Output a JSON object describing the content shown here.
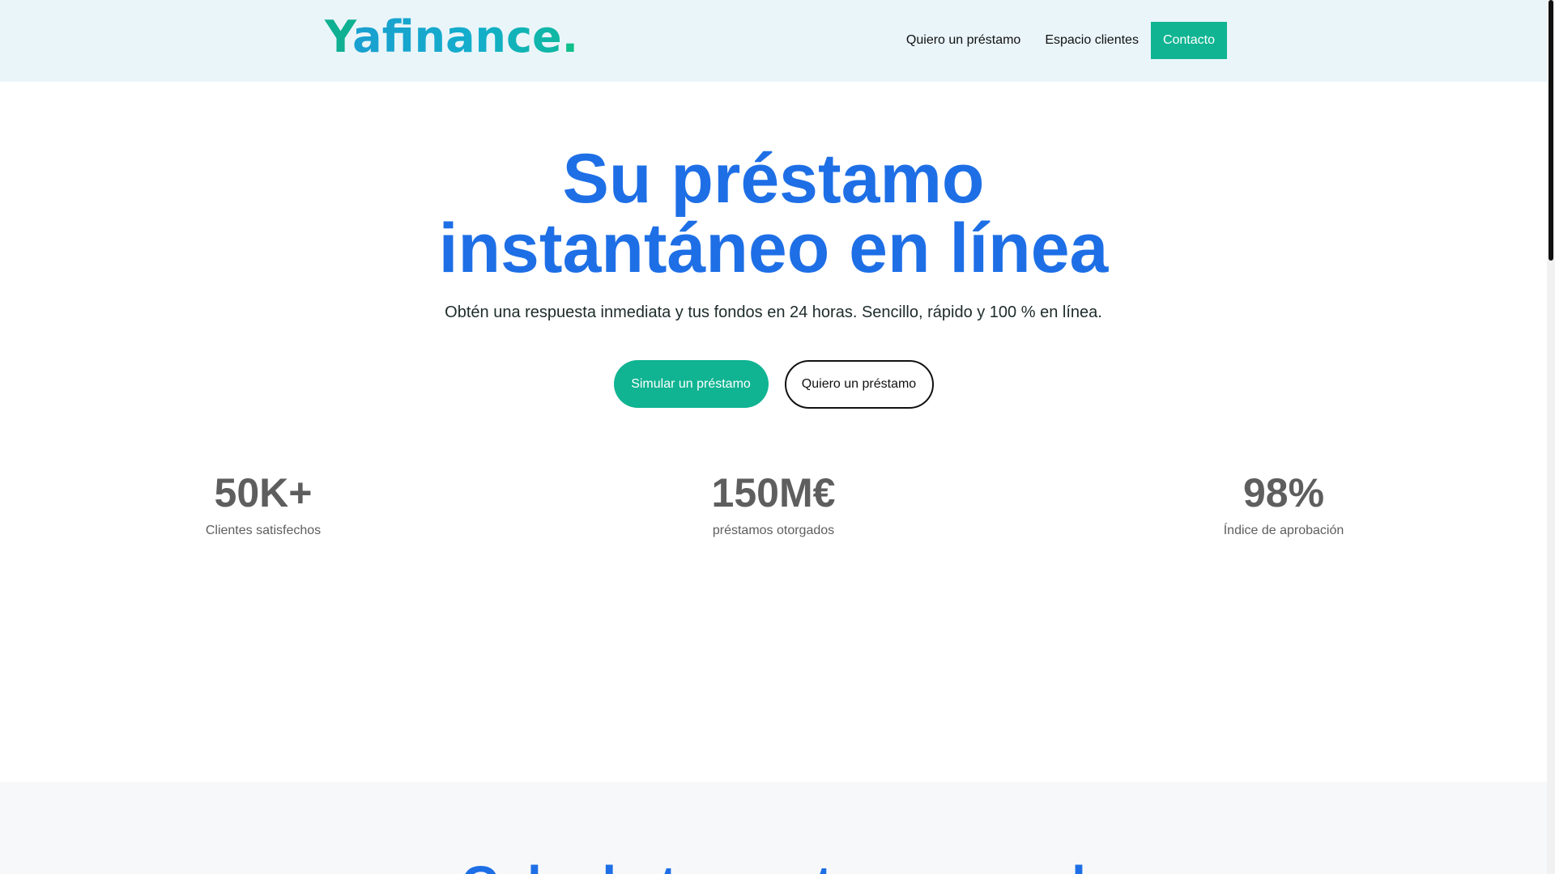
{
  "header": {
    "logo": {
      "y": "Y",
      "rest": "afinance",
      "dot": "."
    },
    "nav": {
      "loan": "Quiero un préstamo",
      "clients": "Espacio clientes",
      "contact": "Contacto"
    }
  },
  "hero": {
    "title_line1": "Su préstamo",
    "title_line2": "instantáneo en línea",
    "subtitle": "Obtén una respuesta inmediata y tus fondos en 24 horas. Sencillo, rápido y 100 % en línea.",
    "cta_simulate": "Simular un préstamo",
    "cta_loan": "Quiero un préstamo"
  },
  "stats": [
    {
      "value": "50K+",
      "label": "Clientes satisfechos"
    },
    {
      "value": "150M€",
      "label": "préstamos otorgados"
    },
    {
      "value": "98%",
      "label": "Índice de aprobación"
    }
  ],
  "next_section": {
    "title": "Calcule tu cuota mensual"
  },
  "colors": {
    "accent": "#10b492",
    "heading_blue": "#1e6fe6",
    "header_bg": "#eaf5fa"
  }
}
